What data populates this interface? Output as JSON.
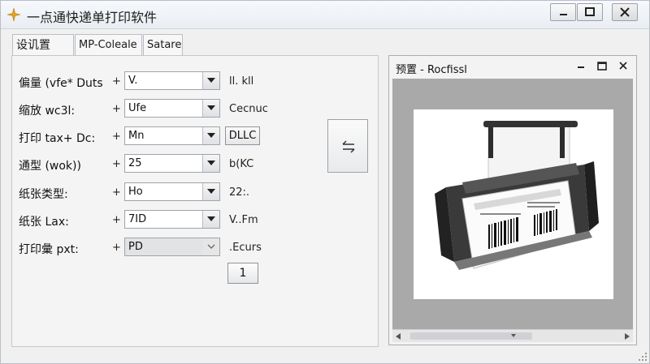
{
  "window": {
    "title": "一点通快递单打印软件",
    "accent_color": "#e8a21a"
  },
  "tabs": [
    {
      "label": "设讥置"
    },
    {
      "label": "MP-Coleale"
    },
    {
      "label": "Satare"
    }
  ],
  "form": {
    "rows": [
      {
        "label": "偏量 (vfe* Duts",
        "plus": "+",
        "value": "V.",
        "extra": "ll. kll"
      },
      {
        "label": "缩放 wc3l:",
        "plus": "+",
        "value": "Ufe",
        "extra": "Cecnuc"
      },
      {
        "label": "打印 tax+ Dc:",
        "plus": "+",
        "value": "Mn",
        "extra": "DLLC"
      },
      {
        "label": "通型 (wok))",
        "plus": "+",
        "value": "25",
        "extra": "b(KC"
      },
      {
        "label": "纸张类型:",
        "plus": "+",
        "value": "Ho",
        "extra": "22:."
      },
      {
        "label": "纸张 Lax:",
        "plus": "+",
        "value": "7ID",
        "extra": "V..Fm"
      },
      {
        "label": "打印彙 pxt:",
        "plus": "+",
        "value": "PD",
        "extra": ".Ecurs"
      }
    ],
    "small_button": "1"
  },
  "preview": {
    "title": "预置 - Rocfissl"
  },
  "icons": {
    "app": "app-logo-icon",
    "minimize": "minimize-icon",
    "maximize": "maximize-icon",
    "close": "close-icon",
    "swap": "swap-arrows-icon",
    "printer": "printer-icon"
  }
}
